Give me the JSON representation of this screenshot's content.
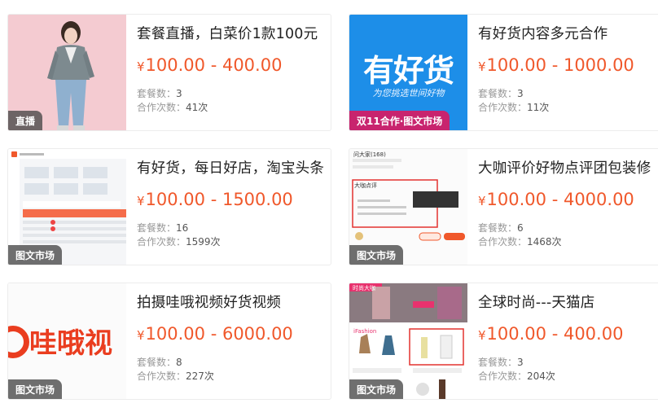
{
  "cards": [
    {
      "title": "套餐直播，白菜价1款100元",
      "currency": "¥",
      "price": "100.00 - 400.00",
      "packages_label": "套餐数：",
      "packages": "3",
      "coop_label": "合作次数：",
      "coop": "41次",
      "tag": "直播",
      "thumb": "fashion-model-photo"
    },
    {
      "title": "有好货内容多元合作",
      "currency": "¥",
      "price": "100.00 - 1000.00",
      "packages_label": "套餐数：",
      "packages": "3",
      "coop_label": "合作次数：",
      "coop": "11次",
      "tag": "双11合作·图文市场",
      "thumb_logo": "有好货",
      "thumb_sub": "为您挑选世间好物"
    },
    {
      "title": "有好货，每日好店，淘宝头条",
      "currency": "¥",
      "price": "100.00 - 1500.00",
      "packages_label": "套餐数：",
      "packages": "16",
      "coop_label": "合作次数：",
      "coop": "1599次",
      "tag": "图文市场",
      "thumb": "dashboard-screenshot"
    },
    {
      "title": "大咖评价好物点评团包装修",
      "currency": "¥",
      "price": "100.00 - 4000.00",
      "packages_label": "套餐数：",
      "packages": "6",
      "coop_label": "合作次数：",
      "coop": "1468次",
      "tag": "图文市场",
      "thumb_top": "问大家(168)",
      "thumb_box": "大咖点评"
    },
    {
      "title": "拍摄哇哦视频好货视频",
      "currency": "¥",
      "price": "100.00 - 6000.00",
      "packages_label": "套餐数：",
      "packages": "8",
      "coop_label": "合作次数：",
      "coop": "227次",
      "tag": "图文市场",
      "thumb_logo": "哇哦视"
    },
    {
      "title": "全球时尚---天猫店",
      "currency": "¥",
      "price": "100.00 - 400.00",
      "packages_label": "套餐数：",
      "packages": "3",
      "coop_label": "合作次数：",
      "coop": "204次",
      "tag": "图文市场",
      "thumb_head": "时尚大咖",
      "thumb_brand": "iFashion"
    }
  ],
  "colors": {
    "price": "#f0582b",
    "tag_bg": "#464646",
    "tag_pink": "#c8246e",
    "logo_blue": "#1d8ee8"
  }
}
